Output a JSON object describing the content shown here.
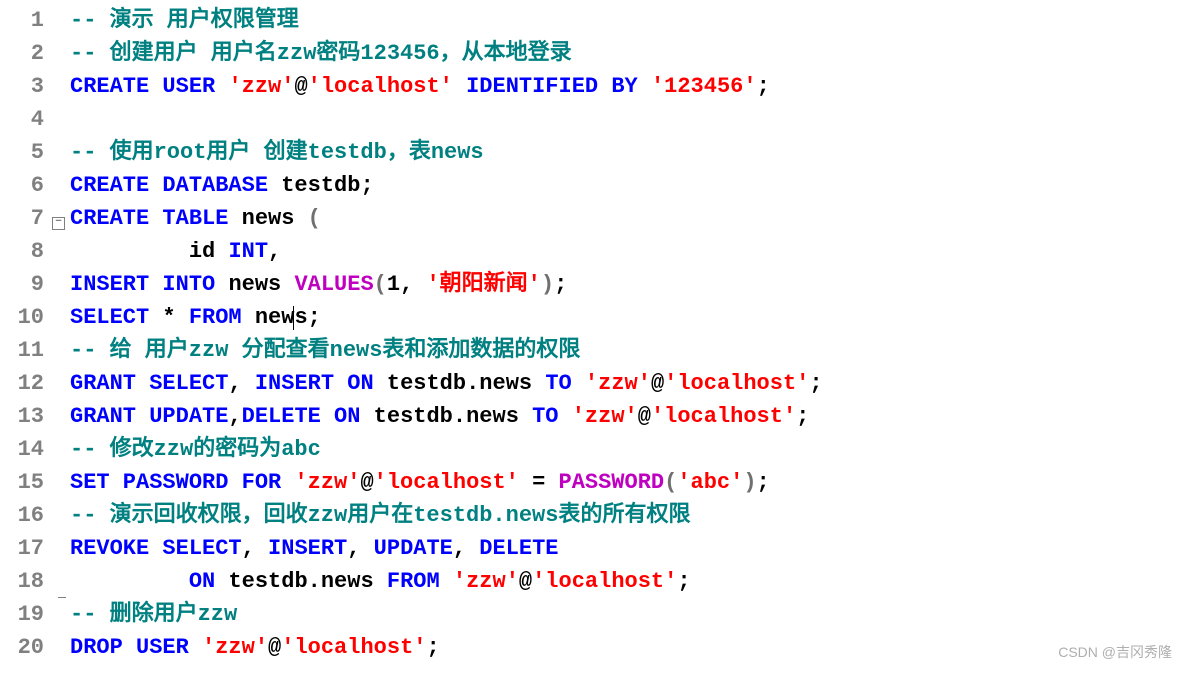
{
  "watermark": "CSDN @吉冈秀隆",
  "fold": {
    "start": 7,
    "end": 19,
    "symbol": "−"
  },
  "lines": [
    {
      "n": 1,
      "tokens": [
        {
          "t": "-- 演示 用户权限管理",
          "c": "cm"
        }
      ]
    },
    {
      "n": 2,
      "tokens": [
        {
          "t": "-- 创建用户 用户名zzw密码123456，从本地登录",
          "c": "cm"
        }
      ]
    },
    {
      "n": 3,
      "tokens": [
        {
          "t": "CREATE USER ",
          "c": "kw"
        },
        {
          "t": "'zzw'",
          "c": "st"
        },
        {
          "t": "@",
          "c": "id"
        },
        {
          "t": "'localhost'",
          "c": "st"
        },
        {
          "t": " ",
          "c": "id"
        },
        {
          "t": "IDENTIFIED BY ",
          "c": "kw"
        },
        {
          "t": "'123456'",
          "c": "st"
        },
        {
          "t": ";",
          "c": "op"
        }
      ]
    },
    {
      "n": 4,
      "tokens": []
    },
    {
      "n": 5,
      "tokens": [
        {
          "t": "-- 使用root用户 创建testdb，表news",
          "c": "cm"
        }
      ]
    },
    {
      "n": 6,
      "tokens": [
        {
          "t": "CREATE DATABASE ",
          "c": "kw"
        },
        {
          "t": "testdb",
          "c": "id"
        },
        {
          "t": ";",
          "c": "op"
        }
      ]
    },
    {
      "n": 7,
      "tokens": [
        {
          "t": "CREATE TABLE ",
          "c": "kw"
        },
        {
          "t": "news ",
          "c": "id"
        },
        {
          "t": "(",
          "c": "gray"
        }
      ]
    },
    {
      "n": 8,
      "tokens": [
        {
          "t": "         id ",
          "c": "id"
        },
        {
          "t": "INT",
          "c": "kw"
        },
        {
          "t": ",",
          "c": "op"
        }
      ]
    },
    {
      "n": 9,
      "tokens": [
        {
          "t": "INSERT INTO ",
          "c": "kw"
        },
        {
          "t": "news ",
          "c": "id"
        },
        {
          "t": "VALUES",
          "c": "fn"
        },
        {
          "t": "(",
          "c": "gray"
        },
        {
          "t": "1",
          "c": "nm"
        },
        {
          "t": ", ",
          "c": "op"
        },
        {
          "t": "'朝阳新闻'",
          "c": "st"
        },
        {
          "t": ")",
          "c": "gray"
        },
        {
          "t": ";",
          "c": "op"
        }
      ]
    },
    {
      "n": 10,
      "tokens": [
        {
          "t": "SELECT ",
          "c": "kw"
        },
        {
          "t": "* ",
          "c": "id"
        },
        {
          "t": "FROM ",
          "c": "kw"
        },
        {
          "t": "new",
          "c": "id"
        },
        {
          "t": "",
          "c": "id",
          "cursor": true
        },
        {
          "t": "s",
          "c": "id"
        },
        {
          "t": ";",
          "c": "op"
        }
      ]
    },
    {
      "n": 11,
      "tokens": [
        {
          "t": "-- 给 用户zzw 分配查看news表和添加数据的权限",
          "c": "cm"
        }
      ]
    },
    {
      "n": 12,
      "tokens": [
        {
          "t": "GRANT SELECT",
          "c": "kw"
        },
        {
          "t": ", ",
          "c": "op"
        },
        {
          "t": "INSERT ON ",
          "c": "kw"
        },
        {
          "t": "testdb.news ",
          "c": "id"
        },
        {
          "t": "TO ",
          "c": "kw"
        },
        {
          "t": "'zzw'",
          "c": "st"
        },
        {
          "t": "@",
          "c": "id"
        },
        {
          "t": "'localhost'",
          "c": "st"
        },
        {
          "t": ";",
          "c": "op"
        }
      ]
    },
    {
      "n": 13,
      "tokens": [
        {
          "t": "GRANT UPDATE",
          "c": "kw"
        },
        {
          "t": ",",
          "c": "op"
        },
        {
          "t": "DELETE ON ",
          "c": "kw"
        },
        {
          "t": "testdb.news ",
          "c": "id"
        },
        {
          "t": "TO ",
          "c": "kw"
        },
        {
          "t": "'zzw'",
          "c": "st"
        },
        {
          "t": "@",
          "c": "id"
        },
        {
          "t": "'localhost'",
          "c": "st"
        },
        {
          "t": ";",
          "c": "op"
        }
      ]
    },
    {
      "n": 14,
      "tokens": [
        {
          "t": "-- 修改zzw的密码为abc",
          "c": "cm"
        }
      ]
    },
    {
      "n": 15,
      "tokens": [
        {
          "t": "SET PASSWORD FOR ",
          "c": "kw"
        },
        {
          "t": "'zzw'",
          "c": "st"
        },
        {
          "t": "@",
          "c": "id"
        },
        {
          "t": "'localhost'",
          "c": "st"
        },
        {
          "t": " = ",
          "c": "op"
        },
        {
          "t": "PASSWORD",
          "c": "fn"
        },
        {
          "t": "(",
          "c": "gray"
        },
        {
          "t": "'abc'",
          "c": "st"
        },
        {
          "t": ")",
          "c": "gray"
        },
        {
          "t": ";",
          "c": "op"
        }
      ]
    },
    {
      "n": 16,
      "tokens": [
        {
          "t": "-- 演示回收权限，回收zzw用户在testdb.news表的所有权限",
          "c": "cm"
        }
      ]
    },
    {
      "n": 17,
      "tokens": [
        {
          "t": "REVOKE SELECT",
          "c": "kw"
        },
        {
          "t": ", ",
          "c": "op"
        },
        {
          "t": "INSERT",
          "c": "kw"
        },
        {
          "t": ", ",
          "c": "op"
        },
        {
          "t": "UPDATE",
          "c": "kw"
        },
        {
          "t": ", ",
          "c": "op"
        },
        {
          "t": "DELETE",
          "c": "kw"
        }
      ]
    },
    {
      "n": 18,
      "tokens": [
        {
          "t": "         ",
          "c": "id"
        },
        {
          "t": "ON ",
          "c": "kw"
        },
        {
          "t": "testdb.news ",
          "c": "id"
        },
        {
          "t": "FROM ",
          "c": "kw"
        },
        {
          "t": "'zzw'",
          "c": "st"
        },
        {
          "t": "@",
          "c": "id"
        },
        {
          "t": "'localhost'",
          "c": "st"
        },
        {
          "t": ";",
          "c": "op"
        }
      ]
    },
    {
      "n": 19,
      "tokens": [
        {
          "t": "-- 删除用户zzw",
          "c": "cm"
        }
      ]
    },
    {
      "n": 20,
      "tokens": [
        {
          "t": "DROP USER ",
          "c": "kw"
        },
        {
          "t": "'zzw'",
          "c": "st"
        },
        {
          "t": "@",
          "c": "id"
        },
        {
          "t": "'localhost'",
          "c": "st"
        },
        {
          "t": ";",
          "c": "op"
        }
      ]
    }
  ]
}
